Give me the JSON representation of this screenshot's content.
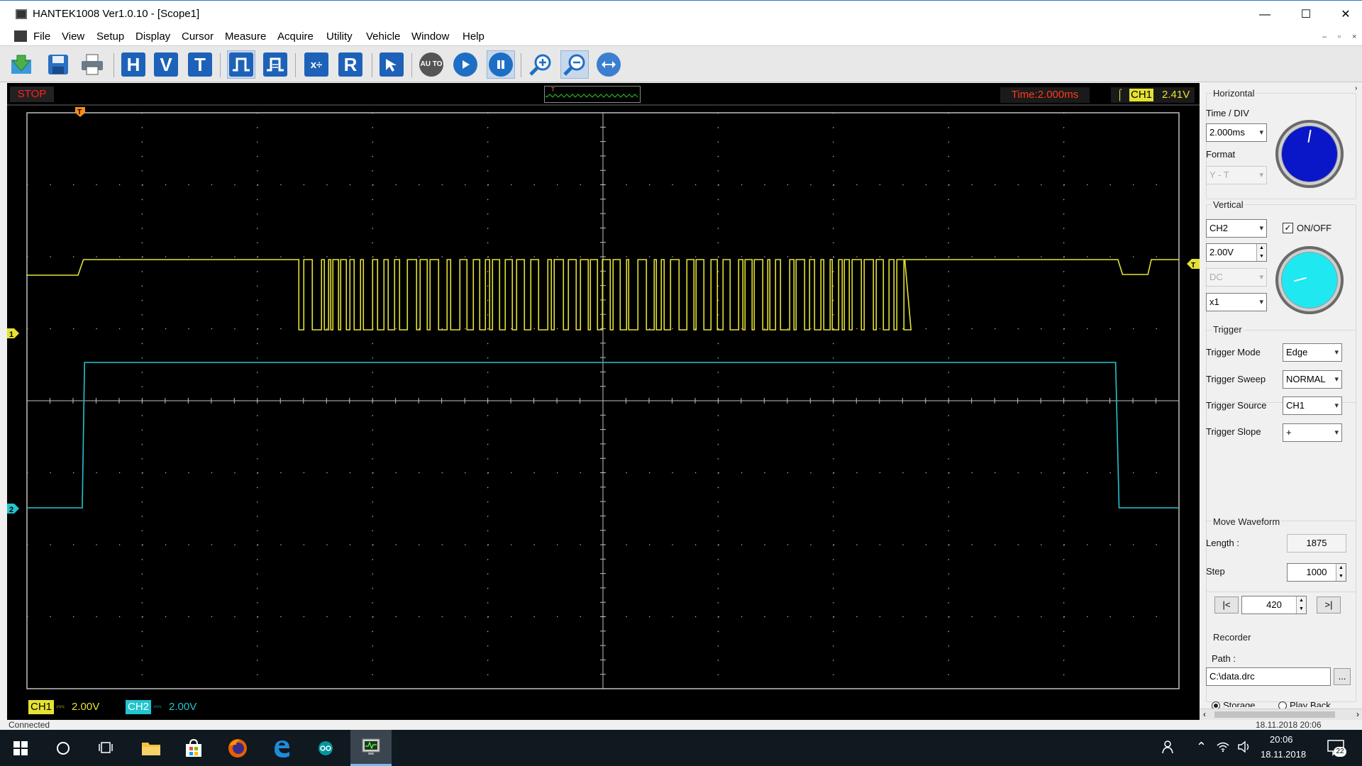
{
  "window": {
    "title": "HANTEK1008 Ver1.0.10 - [Scope1]",
    "minimize": "—",
    "maximize": "☐",
    "close": "✕"
  },
  "menu": [
    "File",
    "View",
    "Setup",
    "Display",
    "Cursor",
    "Measure",
    "Acquire",
    "Utility",
    "Vehicle",
    "Window",
    "Help"
  ],
  "mdi_controls": [
    "–",
    "▫",
    "×"
  ],
  "toolbar": {
    "letters": [
      "H",
      "V",
      "T",
      "R"
    ],
    "auto_label": "AU TO"
  },
  "scope": {
    "run_state": "STOP",
    "time_label": "Time:2.000ms",
    "trigger_channel": "CH1",
    "trigger_level": "2.41V",
    "trigger_marker": "T",
    "ch1_marker": "1",
    "ch2_marker": "2",
    "ch1_label": "CH1",
    "ch1_coupling": "⎓",
    "ch1_scale": "2.00V",
    "ch2_label": "CH2",
    "ch2_coupling": "⎓",
    "ch2_scale": "2.00V",
    "colors": {
      "ch1": "#e6e233",
      "ch2": "#22c5cf",
      "grid": "#c0c0c0",
      "stop": "#ff2020"
    }
  },
  "panel": {
    "horizontal": {
      "title": "Horizontal",
      "time_div_label": "Time / DIV",
      "time_div_value": "2.000ms",
      "format_label": "Format",
      "format_value": "Y - T"
    },
    "vertical": {
      "title": "Vertical",
      "channel": "CH2",
      "onoff_label": "ON/OFF",
      "onoff_checked": true,
      "volts": "2.00V",
      "coupling": "DC",
      "probe": "x1"
    },
    "trigger": {
      "title": "Trigger",
      "mode_label": "Trigger Mode",
      "mode_value": "Edge",
      "sweep_label": "Trigger Sweep",
      "sweep_value": "NORMAL",
      "source_label": "Trigger Source",
      "source_value": "CH1",
      "slope_label": "Trigger Slope",
      "slope_value": "+"
    },
    "move_waveform": {
      "title": "Move Waveform",
      "length_label": "Length :",
      "length_value": "1875",
      "step_label": "Step",
      "step_value": "1000",
      "position_value": "420",
      "first_button": "|<",
      "last_button": ">|"
    },
    "recorder": {
      "title": "Recorder",
      "path_label": "Path :",
      "path_value": "C:\\data.drc",
      "browse_button": "...",
      "storage_label": "Storage",
      "playback_label": "Play Back"
    }
  },
  "statusbar": {
    "left": "Connected",
    "right": "18.11.2018 20:06"
  },
  "taskbar": {
    "time": "20:06",
    "date": "18.11.2018",
    "notifications": "22"
  }
}
